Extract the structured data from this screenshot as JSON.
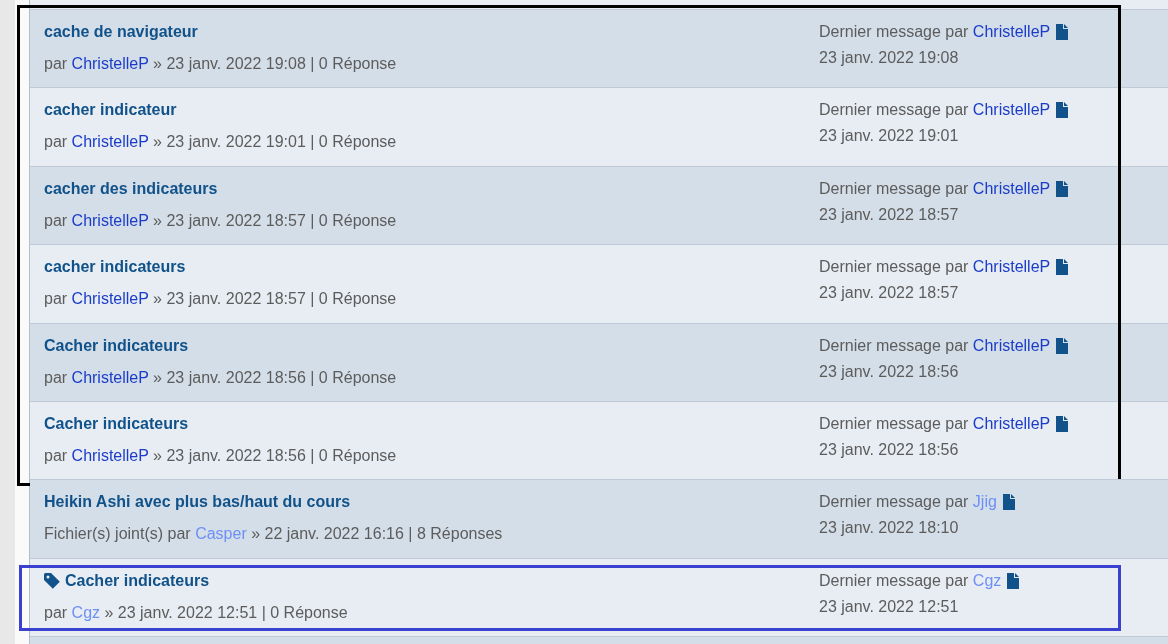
{
  "topic_groups": [
    {
      "color": "#000000",
      "topics": [
        {
          "title": "cache de navigateur",
          "tagged": false,
          "by": "par",
          "author": {
            "name": "ChristelleP",
            "color": "#1b3cc9"
          },
          "details": "» 23 janv. 2022 19:08 | 0 Réponse",
          "last_post": {
            "label": "Dernier message par",
            "author": {
              "name": "ChristelleP",
              "color": "#1b3cc9"
            },
            "date": "23 janv. 2022 19:08"
          }
        },
        {
          "title": "cacher indicateur",
          "tagged": false,
          "by": "par",
          "author": {
            "name": "ChristelleP",
            "color": "#1b3cc9"
          },
          "details": "» 23 janv. 2022 19:01 | 0 Réponse",
          "last_post": {
            "label": "Dernier message par",
            "author": {
              "name": "ChristelleP",
              "color": "#1b3cc9"
            },
            "date": "23 janv. 2022 19:01"
          }
        },
        {
          "title": "cacher des indicateurs",
          "tagged": false,
          "by": "par",
          "author": {
            "name": "ChristelleP",
            "color": "#1b3cc9"
          },
          "details": "» 23 janv. 2022 18:57 | 0 Réponse",
          "last_post": {
            "label": "Dernier message par",
            "author": {
              "name": "ChristelleP",
              "color": "#1b3cc9"
            },
            "date": "23 janv. 2022 18:57"
          }
        },
        {
          "title": "cacher indicateurs",
          "tagged": false,
          "by": "par",
          "author": {
            "name": "ChristelleP",
            "color": "#1b3cc9"
          },
          "details": "» 23 janv. 2022 18:57 | 0 Réponse",
          "last_post": {
            "label": "Dernier message par",
            "author": {
              "name": "ChristelleP",
              "color": "#1b3cc9"
            },
            "date": "23 janv. 2022 18:57"
          }
        },
        {
          "title": "Cacher indicateurs",
          "tagged": false,
          "by": "par",
          "author": {
            "name": "ChristelleP",
            "color": "#1b3cc9"
          },
          "details": "» 23 janv. 2022 18:56 | 0 Réponse",
          "last_post": {
            "label": "Dernier message par",
            "author": {
              "name": "ChristelleP",
              "color": "#1b3cc9"
            },
            "date": "23 janv. 2022 18:56"
          }
        },
        {
          "title": "Cacher indicateurs",
          "tagged": false,
          "by": "par",
          "author": {
            "name": "ChristelleP",
            "color": "#1b3cc9"
          },
          "details": "» 23 janv. 2022 18:56 | 0 Réponse",
          "last_post": {
            "label": "Dernier message par",
            "author": {
              "name": "ChristelleP",
              "color": "#1b3cc9"
            },
            "date": "23 janv. 2022 18:56"
          }
        }
      ]
    },
    {
      "topics": [
        {
          "title": "Heikin Ashi avec plus bas/haut du cours",
          "tagged": false,
          "by": "Fichier(s) joint(s) par",
          "author": {
            "name": "Casper",
            "color": "#6e8ff5"
          },
          "details": "» 22 janv. 2022 16:16 | 8 Réponses",
          "last_post": {
            "label": "Dernier message par",
            "author": {
              "name": "Jjig",
              "color": "#6e8ff5"
            },
            "date": "23 janv. 2022 18:10"
          }
        }
      ]
    },
    {
      "color": "#3b41cf",
      "topics": [
        {
          "title": "Cacher indicateurs",
          "tagged": true,
          "by": "par",
          "author": {
            "name": "Cgz",
            "color": "#6e8ff5"
          },
          "details": "» 23 janv. 2022 12:51 | 0 Réponse",
          "last_post": {
            "label": "Dernier message par",
            "author": {
              "name": "Cgz",
              "color": "#6e8ff5"
            },
            "date": "23 janv. 2022 12:51"
          }
        }
      ]
    }
  ]
}
